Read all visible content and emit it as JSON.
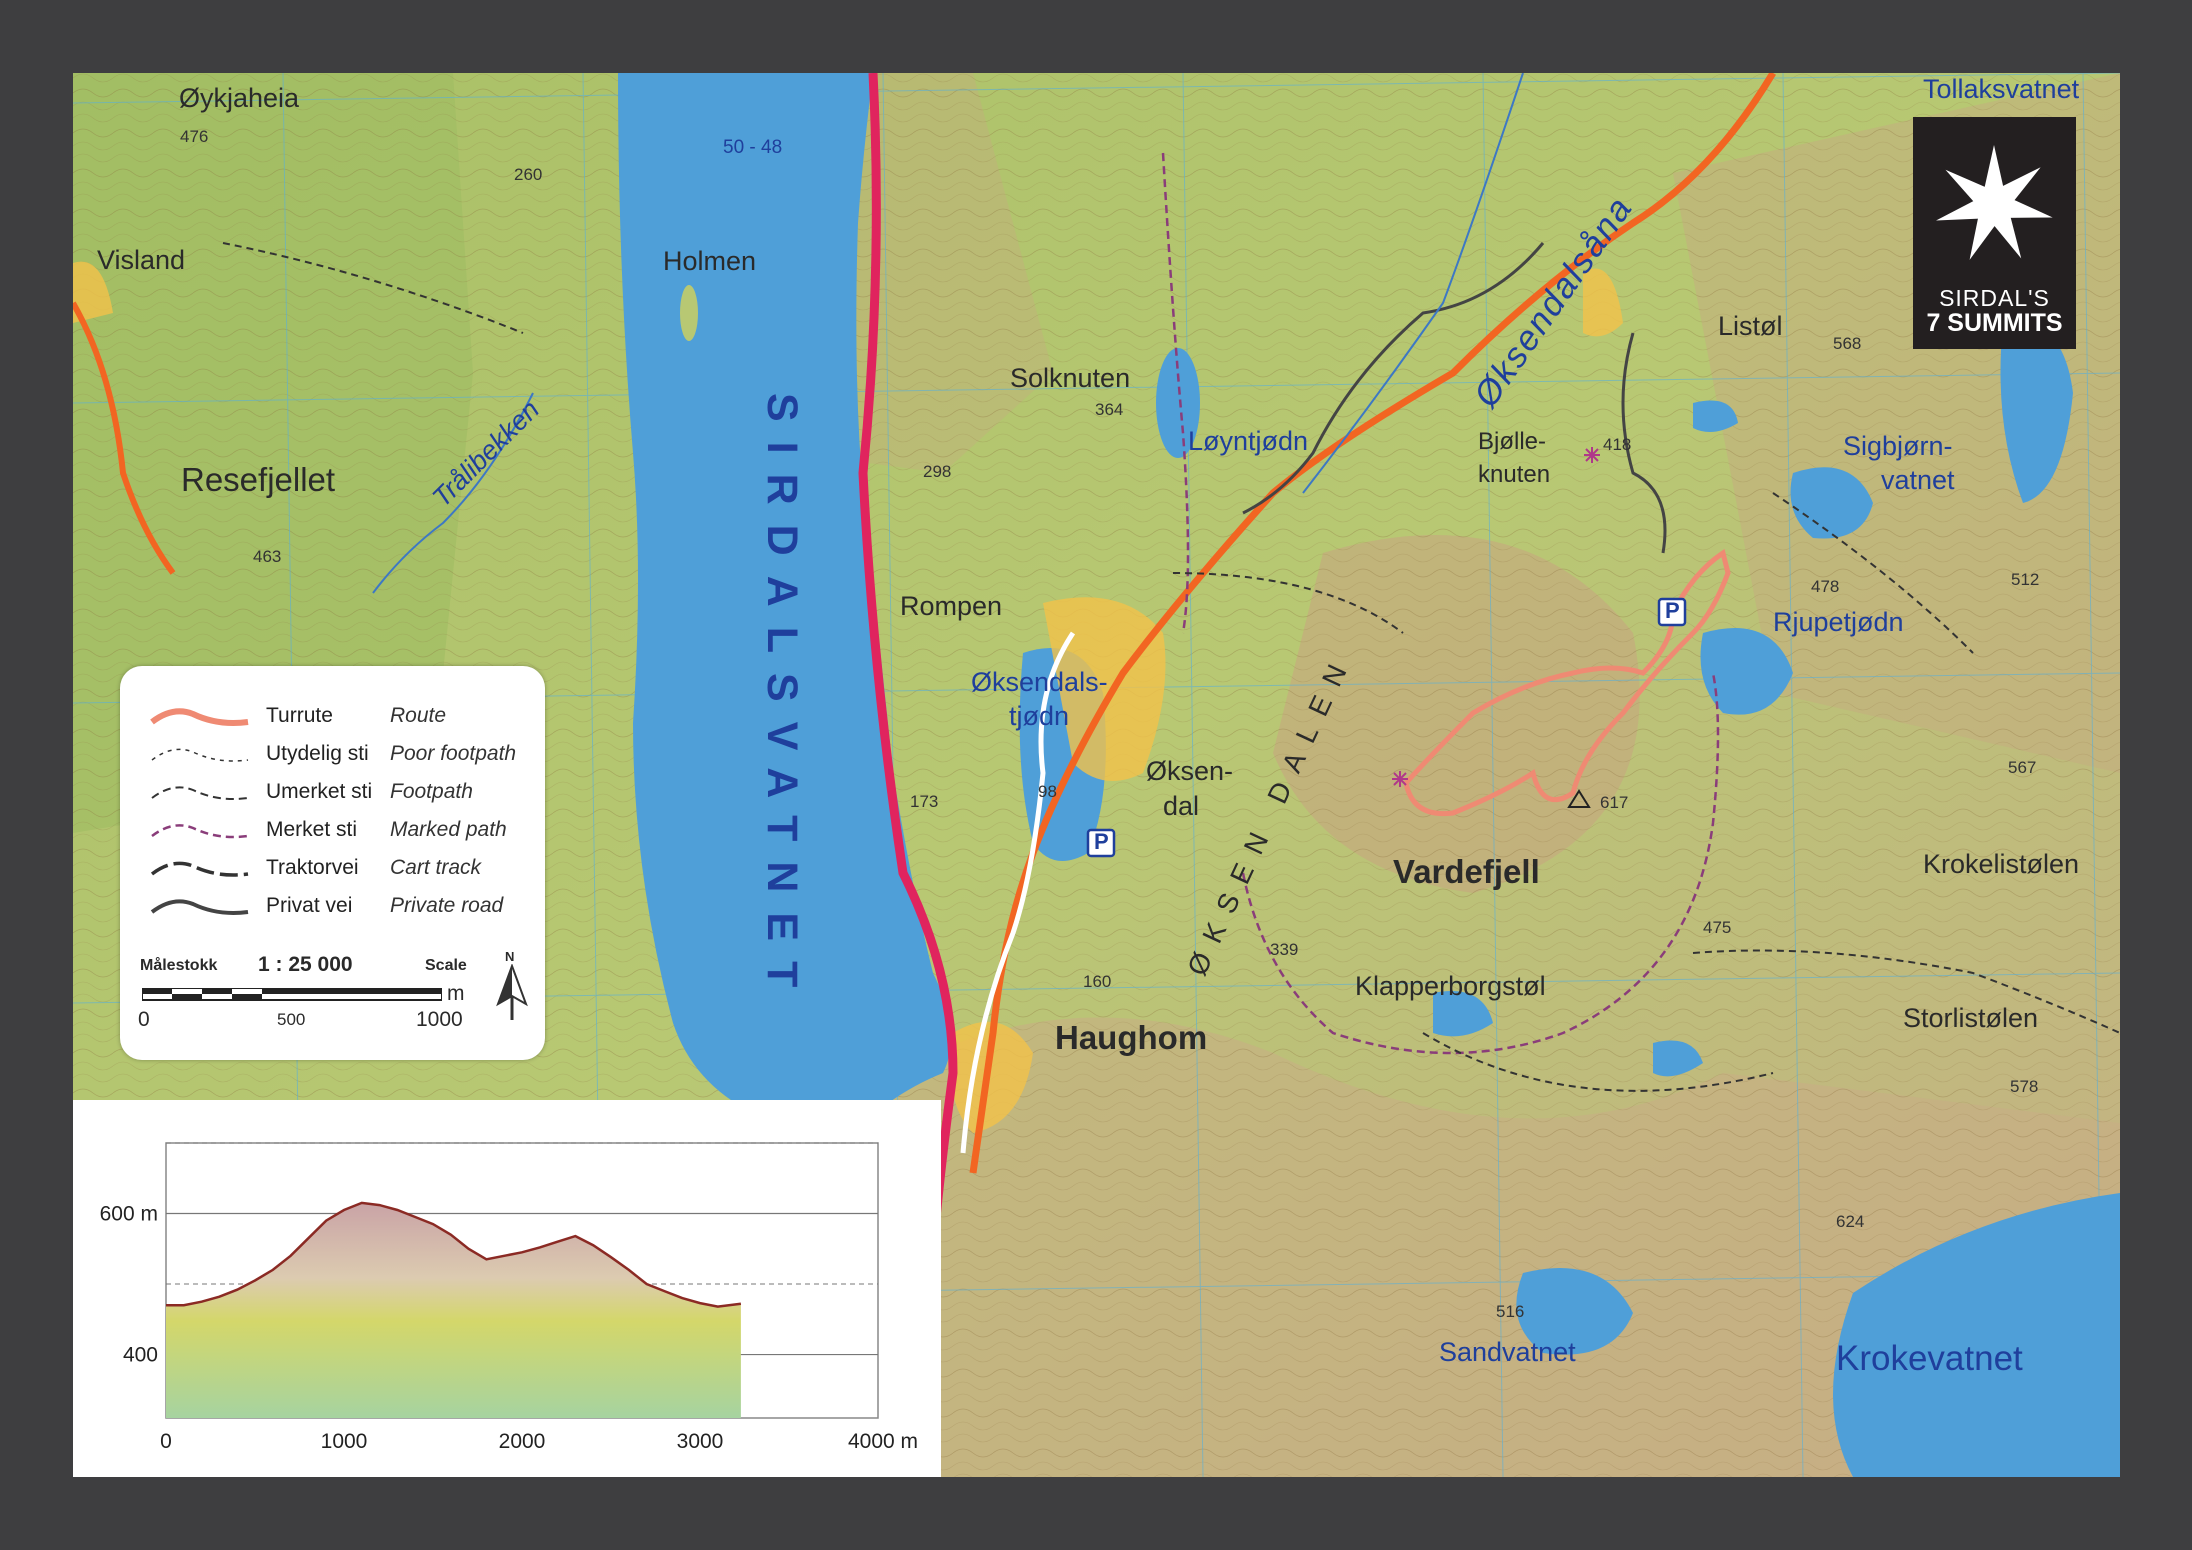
{
  "map": {
    "labels": {
      "oykjaheia": "Øykjaheia",
      "e476": "476",
      "e260": "260",
      "visland": "Visland",
      "resefjellet": "Resefjellet",
      "tralibekken": "Trålibekken",
      "e463": "463",
      "depth": "50 - 48",
      "holmen": "Holmen",
      "sirdalsvatnet": "SIRDALSVATNET",
      "solknuten": "Solknuten",
      "e364": "364",
      "loyntjodn": "Løyntjødn",
      "e298": "298",
      "rompen": "Rompen",
      "oksendalstjodn_1": "Øksendals-",
      "oksendalstjodn_2": "tjødn",
      "e98": "98",
      "e173": "173",
      "oksendal_1": "Øksen-",
      "oksendal_2": "dal",
      "oksendalen": "ØKSEN DALEN",
      "oksendalsana": "Øksendalsåna",
      "bjolleknuten_1": "Bjølle-",
      "bjolleknuten_2": "knuten",
      "e418": "418",
      "listol": "Listøl",
      "e568": "568",
      "tollaksvatnet": "Tollaksvatnet",
      "sigbjorn_1": "Sigbjørn-",
      "sigbjorn_2": "vatnet",
      "e478": "478",
      "e512": "512",
      "rjupetjodn": "Rjupetjødn",
      "e617": "617",
      "vardefjell": "Vardefjell",
      "e567": "567",
      "krokelistolen": "Krokelistølen",
      "e475": "475",
      "e339": "339",
      "klapperborgstol": "Klapperborgstøl",
      "e160": "160",
      "haughom": "Haughom",
      "storlistolen": "Storlistølen",
      "e578": "578",
      "e624": "624",
      "e516": "516",
      "sandvatnet": "Sandvatnet",
      "krokevatnet": "Krokevatnet",
      "parking": "P"
    },
    "colors": {
      "water": "#4f9fd8",
      "land_low": "#b9cc6e",
      "land_high": "#c9ab82",
      "route": "#ef8a73",
      "road": "#e0245e",
      "main_road": "#f26522"
    }
  },
  "legend": {
    "rows": [
      {
        "no": "Turrute",
        "en": "Route"
      },
      {
        "no": "Utydelig sti",
        "en": "Poor footpath"
      },
      {
        "no": "Umerket sti",
        "en": "Footpath"
      },
      {
        "no": "Merket sti",
        "en": "Marked path"
      },
      {
        "no": "Traktorvei",
        "en": "Cart track"
      },
      {
        "no": "Privat vei",
        "en": "Private road"
      }
    ],
    "scale_label": "Målestokk",
    "scale_value": "1 : 25 000",
    "scale_en": "Scale",
    "scale_unit": "m",
    "scale_ticks": [
      "0",
      "500",
      "1000"
    ],
    "north": "N"
  },
  "logo": {
    "line1": "SIRDAL'S",
    "line2": "7 SUMMITS"
  },
  "chart_data": {
    "type": "area",
    "title": "",
    "xlabel": "",
    "ylabel": "",
    "x_unit": "m",
    "y_unit": "m",
    "xlim": [
      0,
      4000
    ],
    "ylim": [
      310,
      700
    ],
    "x_ticks": [
      0,
      1000,
      2000,
      3000,
      4000
    ],
    "x_tick_labels": [
      "0",
      "1000",
      "2000",
      "3000",
      "4000 m"
    ],
    "y_ticks": [
      400,
      600
    ],
    "y_tick_labels": [
      "400",
      "600 m"
    ],
    "grid": true,
    "series": [
      {
        "x": [
          0,
          100,
          200,
          300,
          400,
          500,
          600,
          700,
          800,
          900,
          1000,
          1100,
          1200,
          1300,
          1400,
          1500,
          1600,
          1700,
          1800,
          1900,
          2000,
          2100,
          2200,
          2300,
          2400,
          2500,
          2600,
          2700,
          2800,
          2900,
          3000,
          3100,
          3230
        ],
        "y": [
          470,
          470,
          475,
          482,
          492,
          505,
          520,
          540,
          565,
          590,
          605,
          615,
          612,
          605,
          595,
          585,
          570,
          550,
          535,
          540,
          545,
          552,
          560,
          568,
          555,
          538,
          520,
          500,
          490,
          480,
          473,
          468,
          472
        ]
      }
    ]
  }
}
